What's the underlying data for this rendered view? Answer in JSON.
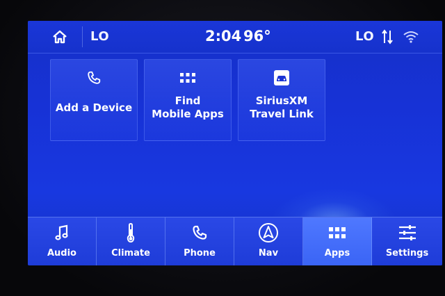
{
  "status_bar": {
    "home_icon": "home-icon",
    "left_climate": "LO",
    "time": "2:04",
    "temperature": "96°",
    "right_climate": "LO",
    "sort_icon": "sort-arrows-icon",
    "wifi_icon": "wifi-icon"
  },
  "apps": [
    {
      "label_line1": "Add a Device",
      "label_line2": "",
      "icon": "phone-icon"
    },
    {
      "label_line1": "Find",
      "label_line2": "Mobile Apps",
      "icon": "apps-grid-icon"
    },
    {
      "label_line1": "SiriusXM",
      "label_line2": "Travel Link",
      "icon": "car-icon"
    }
  ],
  "nav": {
    "items": [
      {
        "label": "Audio",
        "icon": "music-note-icon"
      },
      {
        "label": "Climate",
        "icon": "thermometer-icon"
      },
      {
        "label": "Phone",
        "icon": "phone-icon"
      },
      {
        "label": "Nav",
        "icon": "navigation-arrow-icon"
      },
      {
        "label": "Apps",
        "icon": "apps-grid-icon",
        "selected": true
      },
      {
        "label": "Settings",
        "icon": "sliders-icon"
      }
    ]
  },
  "colors": {
    "screen_blue": "#1732d6",
    "selected_tab": "#4f78ff",
    "text": "#ffffff"
  }
}
